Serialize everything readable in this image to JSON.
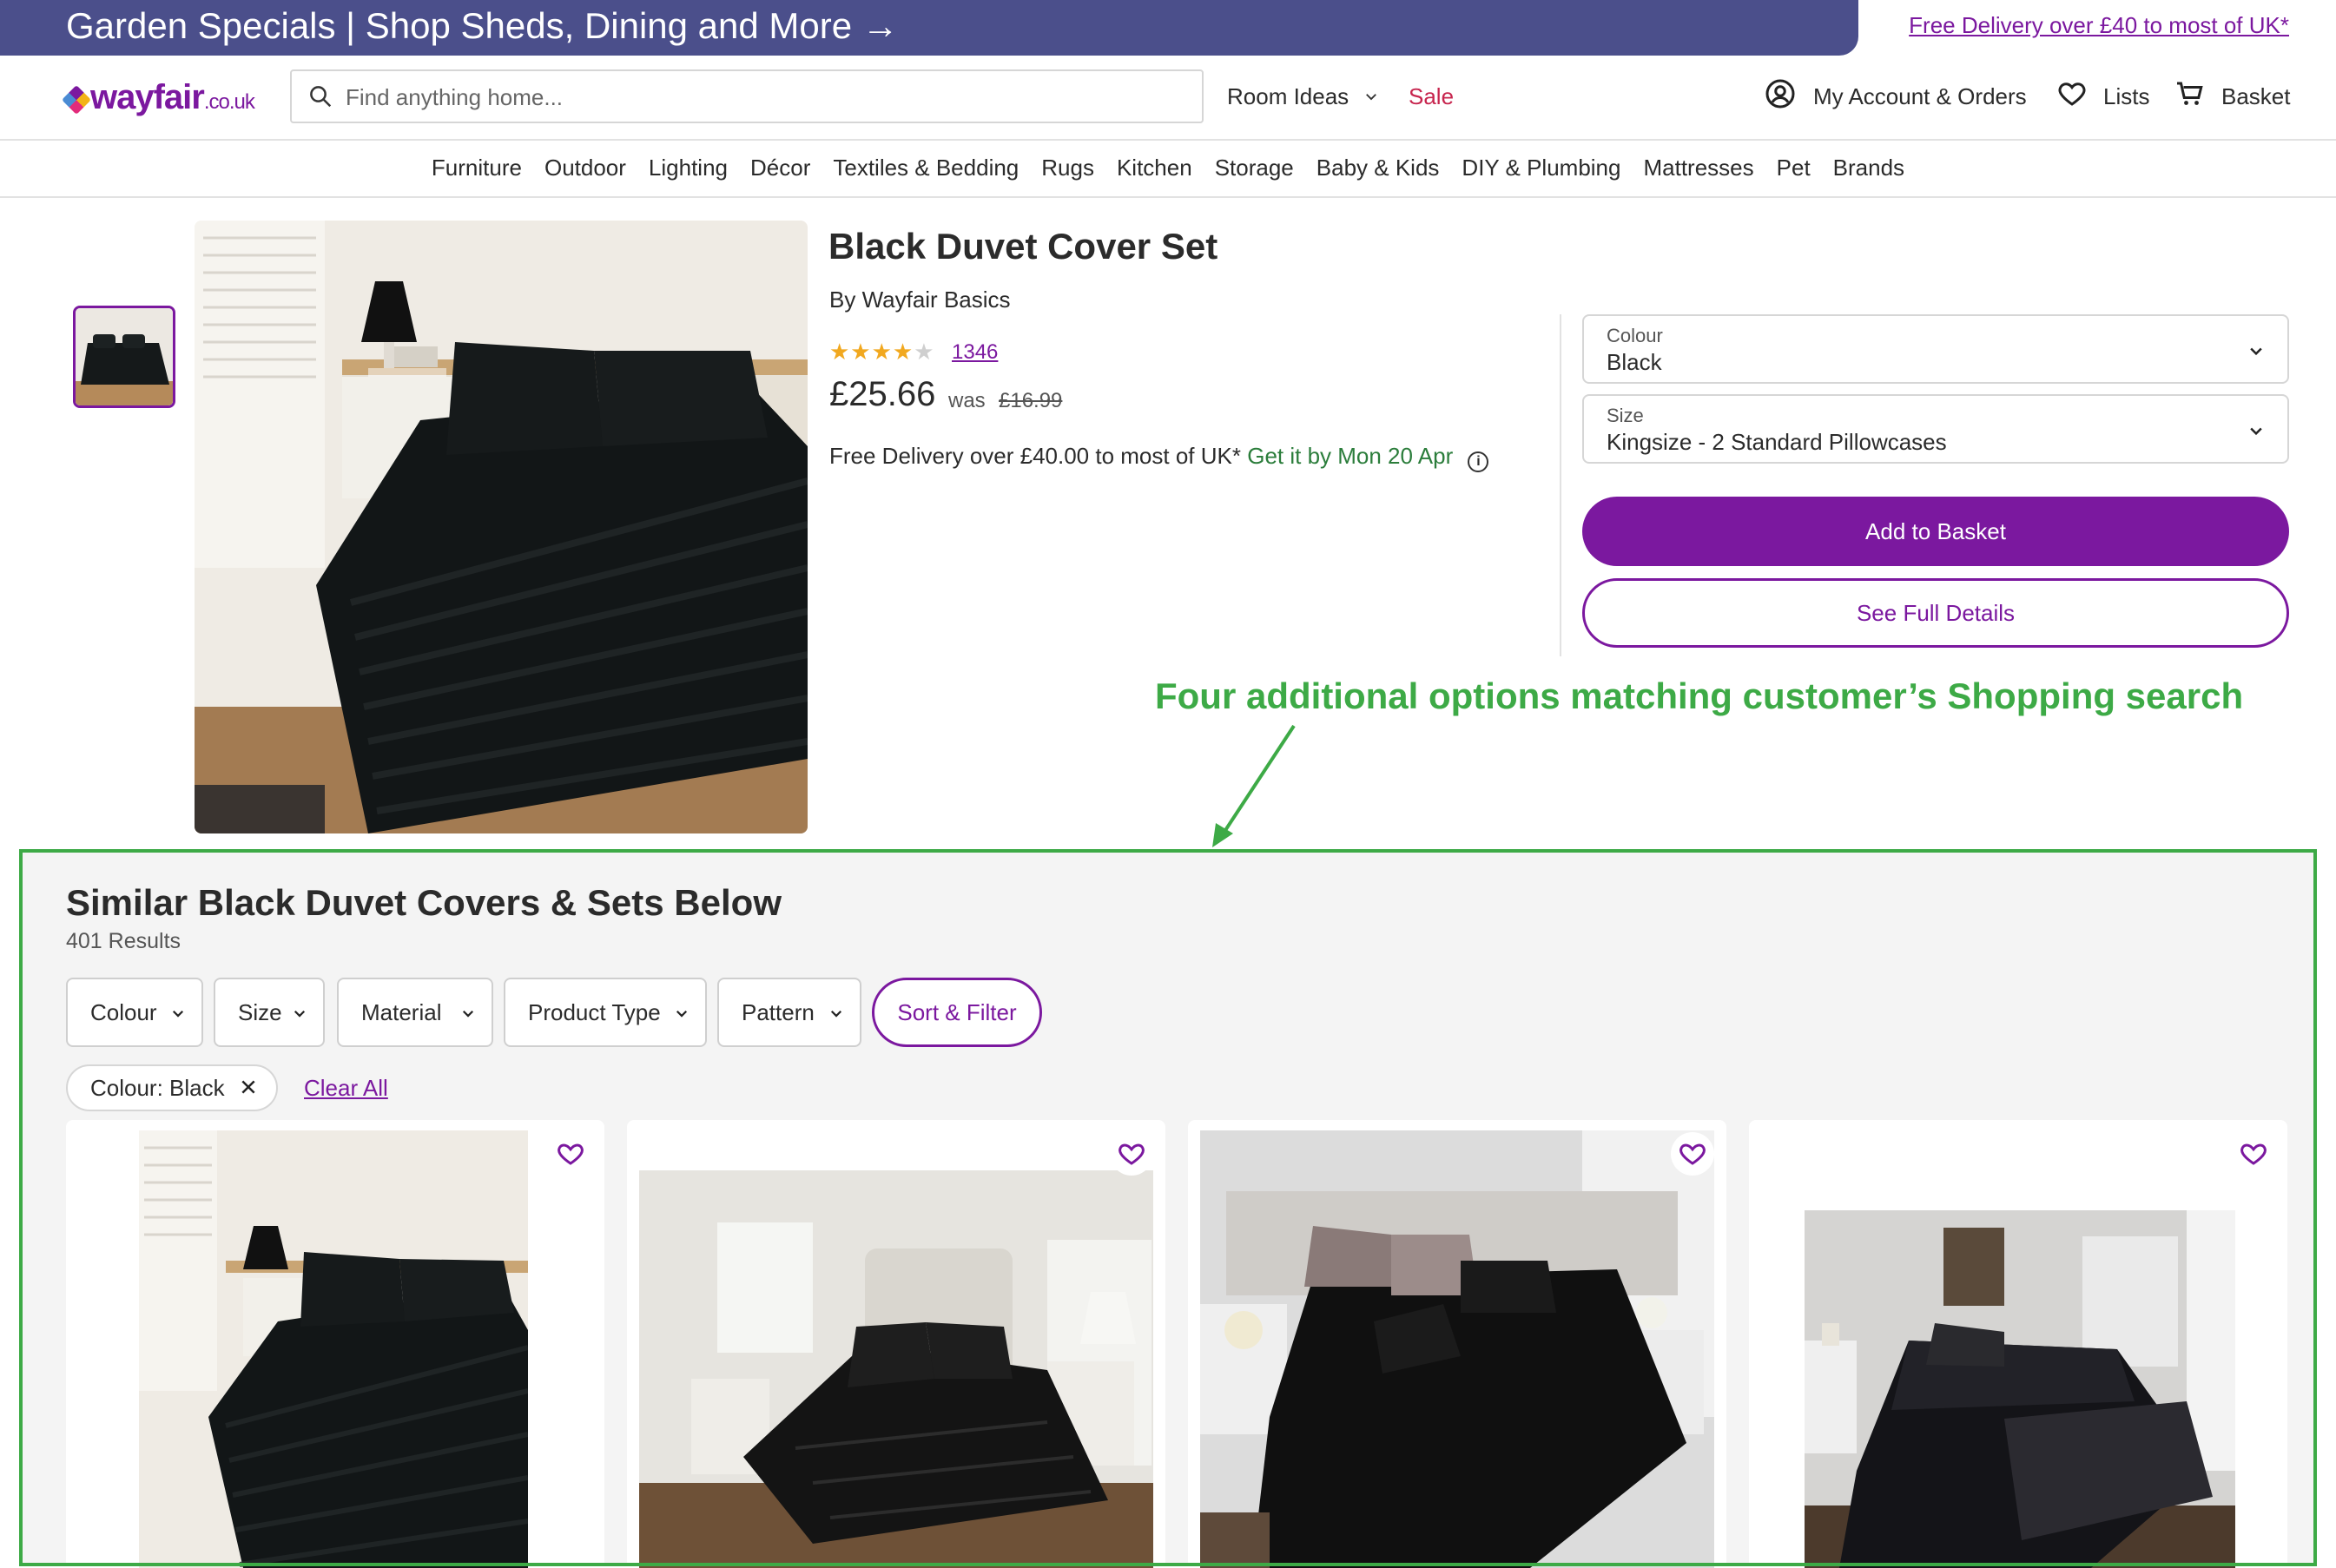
{
  "promo": {
    "left_text": "Garden Specials | Shop Sheds, Dining and More",
    "arrow": "→",
    "right_link": "Free Delivery over £40 to most of UK*"
  },
  "header": {
    "logo": "wayfair",
    "logo_suffix": ".co.uk",
    "search_placeholder": "Find anything home...",
    "room_ideas": "Room Ideas",
    "sale": "Sale",
    "account": "My Account & Orders",
    "lists": "Lists",
    "basket": "Basket"
  },
  "categories": [
    "Furniture",
    "Outdoor",
    "Lighting",
    "Décor",
    "Textiles & Bedding",
    "Rugs",
    "Kitchen",
    "Storage",
    "Baby & Kids",
    "DIY & Plumbing",
    "Mattresses",
    "Pet",
    "Brands"
  ],
  "product": {
    "title": "Black Duvet Cover Set",
    "brand": "By Wayfair Basics",
    "stars_filled": "★★★★",
    "stars_empty": "★",
    "rating": 4,
    "review_count": "1346",
    "price": "£25.66",
    "was_label": "was",
    "was_price": "£16.99",
    "delivery": "Free Delivery over £40.00 to most of UK*",
    "delivery_date": "Get it by Mon 20 Apr",
    "colour_label": "Colour",
    "colour_value": "Black",
    "size_label": "Size",
    "size_value": "Kingsize - 2 Standard Pillowcases",
    "add_to_basket": "Add to Basket",
    "see_full_details": "See Full Details"
  },
  "annotation": "Four additional options matching customer’s Shopping search",
  "similar": {
    "title": "Similar Black Duvet Covers & Sets Below",
    "count": "401 Results",
    "filters": [
      "Colour",
      "Size",
      "Material",
      "Product Type",
      "Pattern"
    ],
    "sort_filter": "Sort & Filter",
    "active_chip": "Colour: Black",
    "clear_all": "Clear All"
  },
  "colors": {
    "brand_purple": "#7b189f",
    "promo_bg": "#4b4f8b",
    "annotation_green": "#3daa46",
    "delivery_green": "#2b7d3b",
    "sale_red": "#c7254e"
  }
}
